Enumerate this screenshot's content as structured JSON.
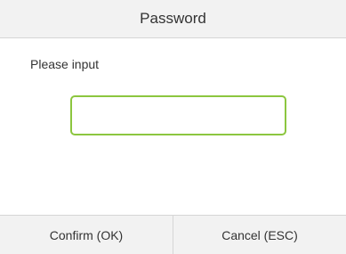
{
  "dialog": {
    "title": "Password",
    "prompt": "Please input",
    "input": {
      "value": "",
      "placeholder": ""
    },
    "buttons": {
      "confirm_label": "Confirm (OK)",
      "cancel_label": "Cancel (ESC)"
    }
  },
  "colors": {
    "input_border": "#8cc63f",
    "bar_background": "#f2f2f2",
    "divider": "#d6d6d6",
    "text": "#333333"
  }
}
